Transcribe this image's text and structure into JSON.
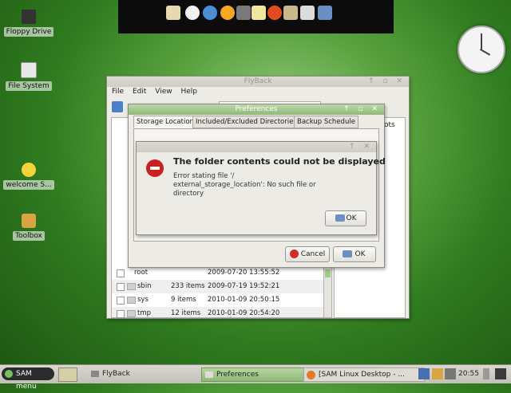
{
  "desktop": {
    "icons": [
      {
        "label": "Floppy Drive",
        "icon": "floppy-icon"
      },
      {
        "label": "File System",
        "icon": "harddisk-icon"
      },
      {
        "label": "welcome S...",
        "icon": "lightbulb-icon"
      },
      {
        "label": "Toolbox",
        "icon": "toolbox-icon"
      }
    ]
  },
  "dock": {
    "icons": [
      "home-icon",
      "clock-icon",
      "browser-icon",
      "mail-icon",
      "music-icon",
      "notes-icon",
      "pdf-icon",
      "wrench-icon",
      "printer-icon",
      "calendar-icon"
    ]
  },
  "flyback": {
    "title": "FlyBack",
    "menu": [
      "File",
      "Edit",
      "View",
      "Help"
    ],
    "side_label": "ots",
    "rows": [
      {
        "name": "root",
        "items": "",
        "date": "2009-07-20 13:55:52"
      },
      {
        "name": "sbin",
        "items": "233 items",
        "date": "2009-07-19 19:52:21"
      },
      {
        "name": "sys",
        "items": "9 items",
        "date": "2010-01-09 20:50:15"
      },
      {
        "name": "tmp",
        "items": "12 items",
        "date": "2010-01-09 20:54:20"
      }
    ]
  },
  "preferences": {
    "title": "Preferences",
    "tabs": [
      "Storage Location",
      "Included/Excluded Directories",
      "Backup Schedule"
    ],
    "cancel_label": "Cancel",
    "ok_label": "OK"
  },
  "error_dialog": {
    "heading": "The folder contents could not be displayed",
    "message": "Error stating file '/\nexternal_storage_location': No such file or\ndirectory",
    "ok_label": "OK"
  },
  "taskbar": {
    "menu_label": "SAM menu",
    "tasks": [
      "FlyBack",
      "Preferences",
      "[SAM Linux Desktop - ..."
    ],
    "time": "20:55"
  },
  "colors": {
    "desktop_green": "#3f8c2a",
    "error_red": "#cc1f1f",
    "title_active": "#8fb878"
  }
}
